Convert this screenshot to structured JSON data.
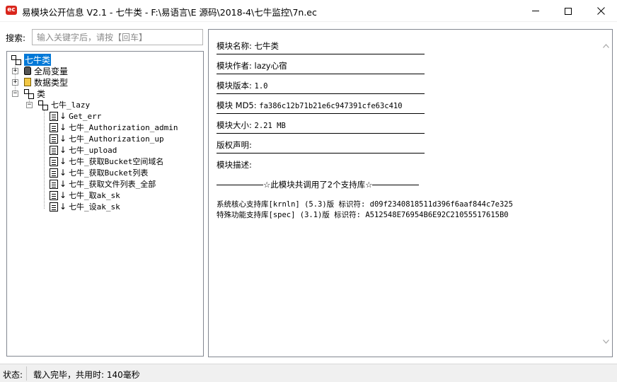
{
  "window": {
    "title": "易模块公开信息 V2.1 - 七牛类 - F:\\易语言\\E 源码\\2018-4\\七牛监控\\7n.ec",
    "app_icon_text": "ec"
  },
  "search": {
    "label": "搜索:",
    "placeholder": "输入关键字后，请按【回车】"
  },
  "tree": {
    "root": "七牛类",
    "nodes": [
      {
        "label": "全局变量"
      },
      {
        "label": "数据类型"
      },
      {
        "label": "类"
      }
    ],
    "class_name": "七牛_lazy",
    "methods": [
      "Get_err",
      "七牛_Authorization_admin",
      "七牛_Authorization_up",
      "七牛_upload",
      "七牛_获取Bucket空间域名",
      "七牛_获取Bucket列表",
      "七牛_获取文件列表_全部",
      "七牛_取ak_sk",
      "七牛_设ak_sk"
    ]
  },
  "info": {
    "name_label": "模块名称:",
    "name_value": "七牛类",
    "author_label": "模块作者:",
    "author_value": "lazy心宿",
    "version_label": "模块版本:",
    "version_value": "1.0",
    "md5_label": "模块 MD5:",
    "md5_value": "fa386c12b71b21e6c947391cfe63c410",
    "size_label": "模块大小:",
    "size_value": "2.21 MB",
    "copyright_label": "版权声明:",
    "desc_label": "模块描述:",
    "libs_summary": "☆此模块共调用了2个支持库☆",
    "libs": [
      "系统核心支持库[krnln] (5.3)版 标识符: d09f2340818511d396f6aaf844c7e325",
      "特殊功能支持库[spec] (3.1)版 标识符: A512548E76954B6E92C21055517615B0"
    ]
  },
  "status": {
    "label": "状态:",
    "text": "载入完毕，共用时: 140毫秒"
  },
  "colors": {
    "selection": "#0078d7",
    "app_icon": "#d9261c",
    "statusbar": "#f0f0f0"
  }
}
